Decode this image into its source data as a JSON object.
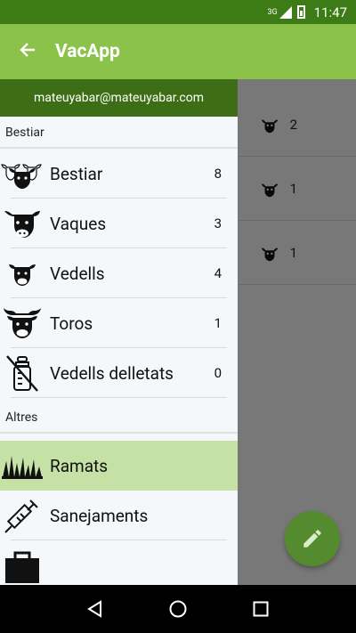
{
  "status": {
    "network": "3G",
    "time": "11:47"
  },
  "appbar": {
    "title": "VacApp"
  },
  "drawer": {
    "email": "mateuyabar@mateuyabar.com",
    "section1": "Bestiar",
    "items1": [
      {
        "label": "Bestiar",
        "count": "8",
        "icon": "cattle-herd-icon"
      },
      {
        "label": "Vaques",
        "count": "3",
        "icon": "cow-icon"
      },
      {
        "label": "Vedells",
        "count": "4",
        "icon": "calf-icon"
      },
      {
        "label": "Toros",
        "count": "1",
        "icon": "bull-icon"
      },
      {
        "label": "Vedells delletats",
        "count": "0",
        "icon": "baby-bottle-crossed-icon"
      }
    ],
    "section2": "Altres",
    "items2": [
      {
        "label": "Ramats",
        "icon": "grass-icon"
      },
      {
        "label": "Sanejaments",
        "icon": "syringe-icon"
      }
    ]
  },
  "background_rows": [
    {
      "count": "2",
      "icon": "calf-icon"
    },
    {
      "count": "1",
      "icon": "calf-icon"
    },
    {
      "count": "1",
      "icon": "calf-icon"
    }
  ],
  "colors": {
    "status_bar": "#3d7b16",
    "app_bar": "#8bc34a",
    "drawer_header": "#3d6e16",
    "selected_item": "#c5e1a5",
    "fab": "#558b2f"
  }
}
